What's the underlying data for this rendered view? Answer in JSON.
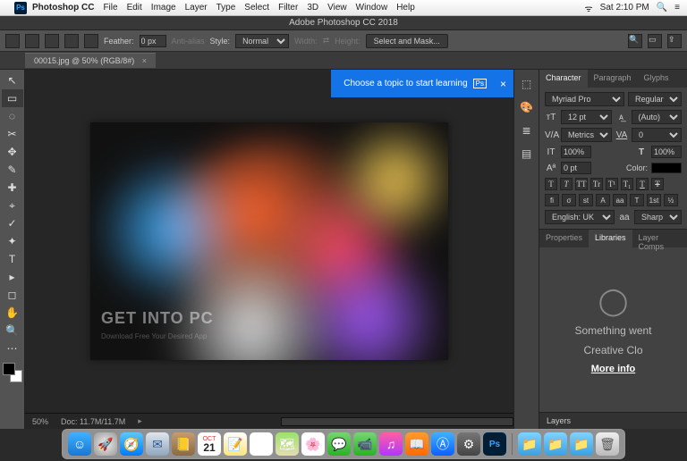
{
  "mac_menubar": {
    "app_abbrev": "Ps",
    "app_name": "Photoshop CC",
    "menus": [
      "File",
      "Edit",
      "Image",
      "Layer",
      "Type",
      "Select",
      "Filter",
      "3D",
      "View",
      "Window",
      "Help"
    ],
    "wifi": "⏚",
    "day_time": "Sat 2:10 PM",
    "spotlight": "🔍",
    "menu_icon": "≡"
  },
  "window_title": "Adobe Photoshop CC 2018",
  "options_bar": {
    "feather_label": "Feather:",
    "feather_value": "0 px",
    "antialias_label": "Anti-alias",
    "style_label": "Style:",
    "style_value": "Normal",
    "width_label": "Width:",
    "swap": "⇄",
    "height_label": "Height:",
    "select_mask": "Select and Mask..."
  },
  "document_tab": {
    "title": "00015.jpg @ 50% (RGB/8#)",
    "close": "×"
  },
  "tools": [
    "↖",
    "▭",
    "◌",
    "✂",
    "✥",
    "✎",
    "✚",
    "⌖",
    "✓",
    "✦",
    "T",
    "▸",
    "◻",
    "✋",
    "🔍",
    "⋯"
  ],
  "swatches": {
    "fg": "#000000",
    "bg": "#ffffff"
  },
  "canvas": {
    "watermark": "GET INTO PC",
    "watermark_sub": "Download Free Your Desired App"
  },
  "tooltip": {
    "text": "Choose a topic to start learning",
    "badge": "Ps",
    "close": "×"
  },
  "status": {
    "zoom": "50%",
    "doc": "Doc: 11.7M/11.7M"
  },
  "icon_strip": [
    "⬚",
    "🎨",
    "≣",
    "▤"
  ],
  "character_panel": {
    "tabs": [
      "Character",
      "Paragraph",
      "Glyphs"
    ],
    "font_family": "Myriad Pro",
    "font_style": "Regular",
    "size_label": "T",
    "size": "12 pt",
    "leading_label": "⅄",
    "leading": "(Auto)",
    "kerning_label": "VA",
    "kerning": "Metrics",
    "tracking_label": "VA",
    "tracking": "0",
    "vscale_label": "IT",
    "vscale": "100%",
    "hscale_label": "T",
    "hscale": "100%",
    "baseline_label": "Aª",
    "baseline": "0 pt",
    "color_label": "Color:",
    "style_buttons": [
      "T",
      "T",
      "TT",
      "Tr",
      "T¹",
      "T₁",
      "T",
      "Ŧ"
    ],
    "liga_buttons": [
      "fi",
      "σ",
      "st",
      "A",
      "aa",
      "T",
      "1st",
      "½"
    ],
    "language": "English: UK",
    "aa_label": "aa",
    "aa": "Sharp"
  },
  "lib_panel": {
    "tabs": [
      "Properties",
      "Libraries",
      "Layer Comps"
    ],
    "line1": "Something went",
    "line2": "Creative Clo",
    "link": "More info"
  },
  "layers_panel": {
    "title": "Layers"
  },
  "dock": {
    "cal_month": "OCT",
    "cal_day": "21",
    "ps": "Ps"
  }
}
